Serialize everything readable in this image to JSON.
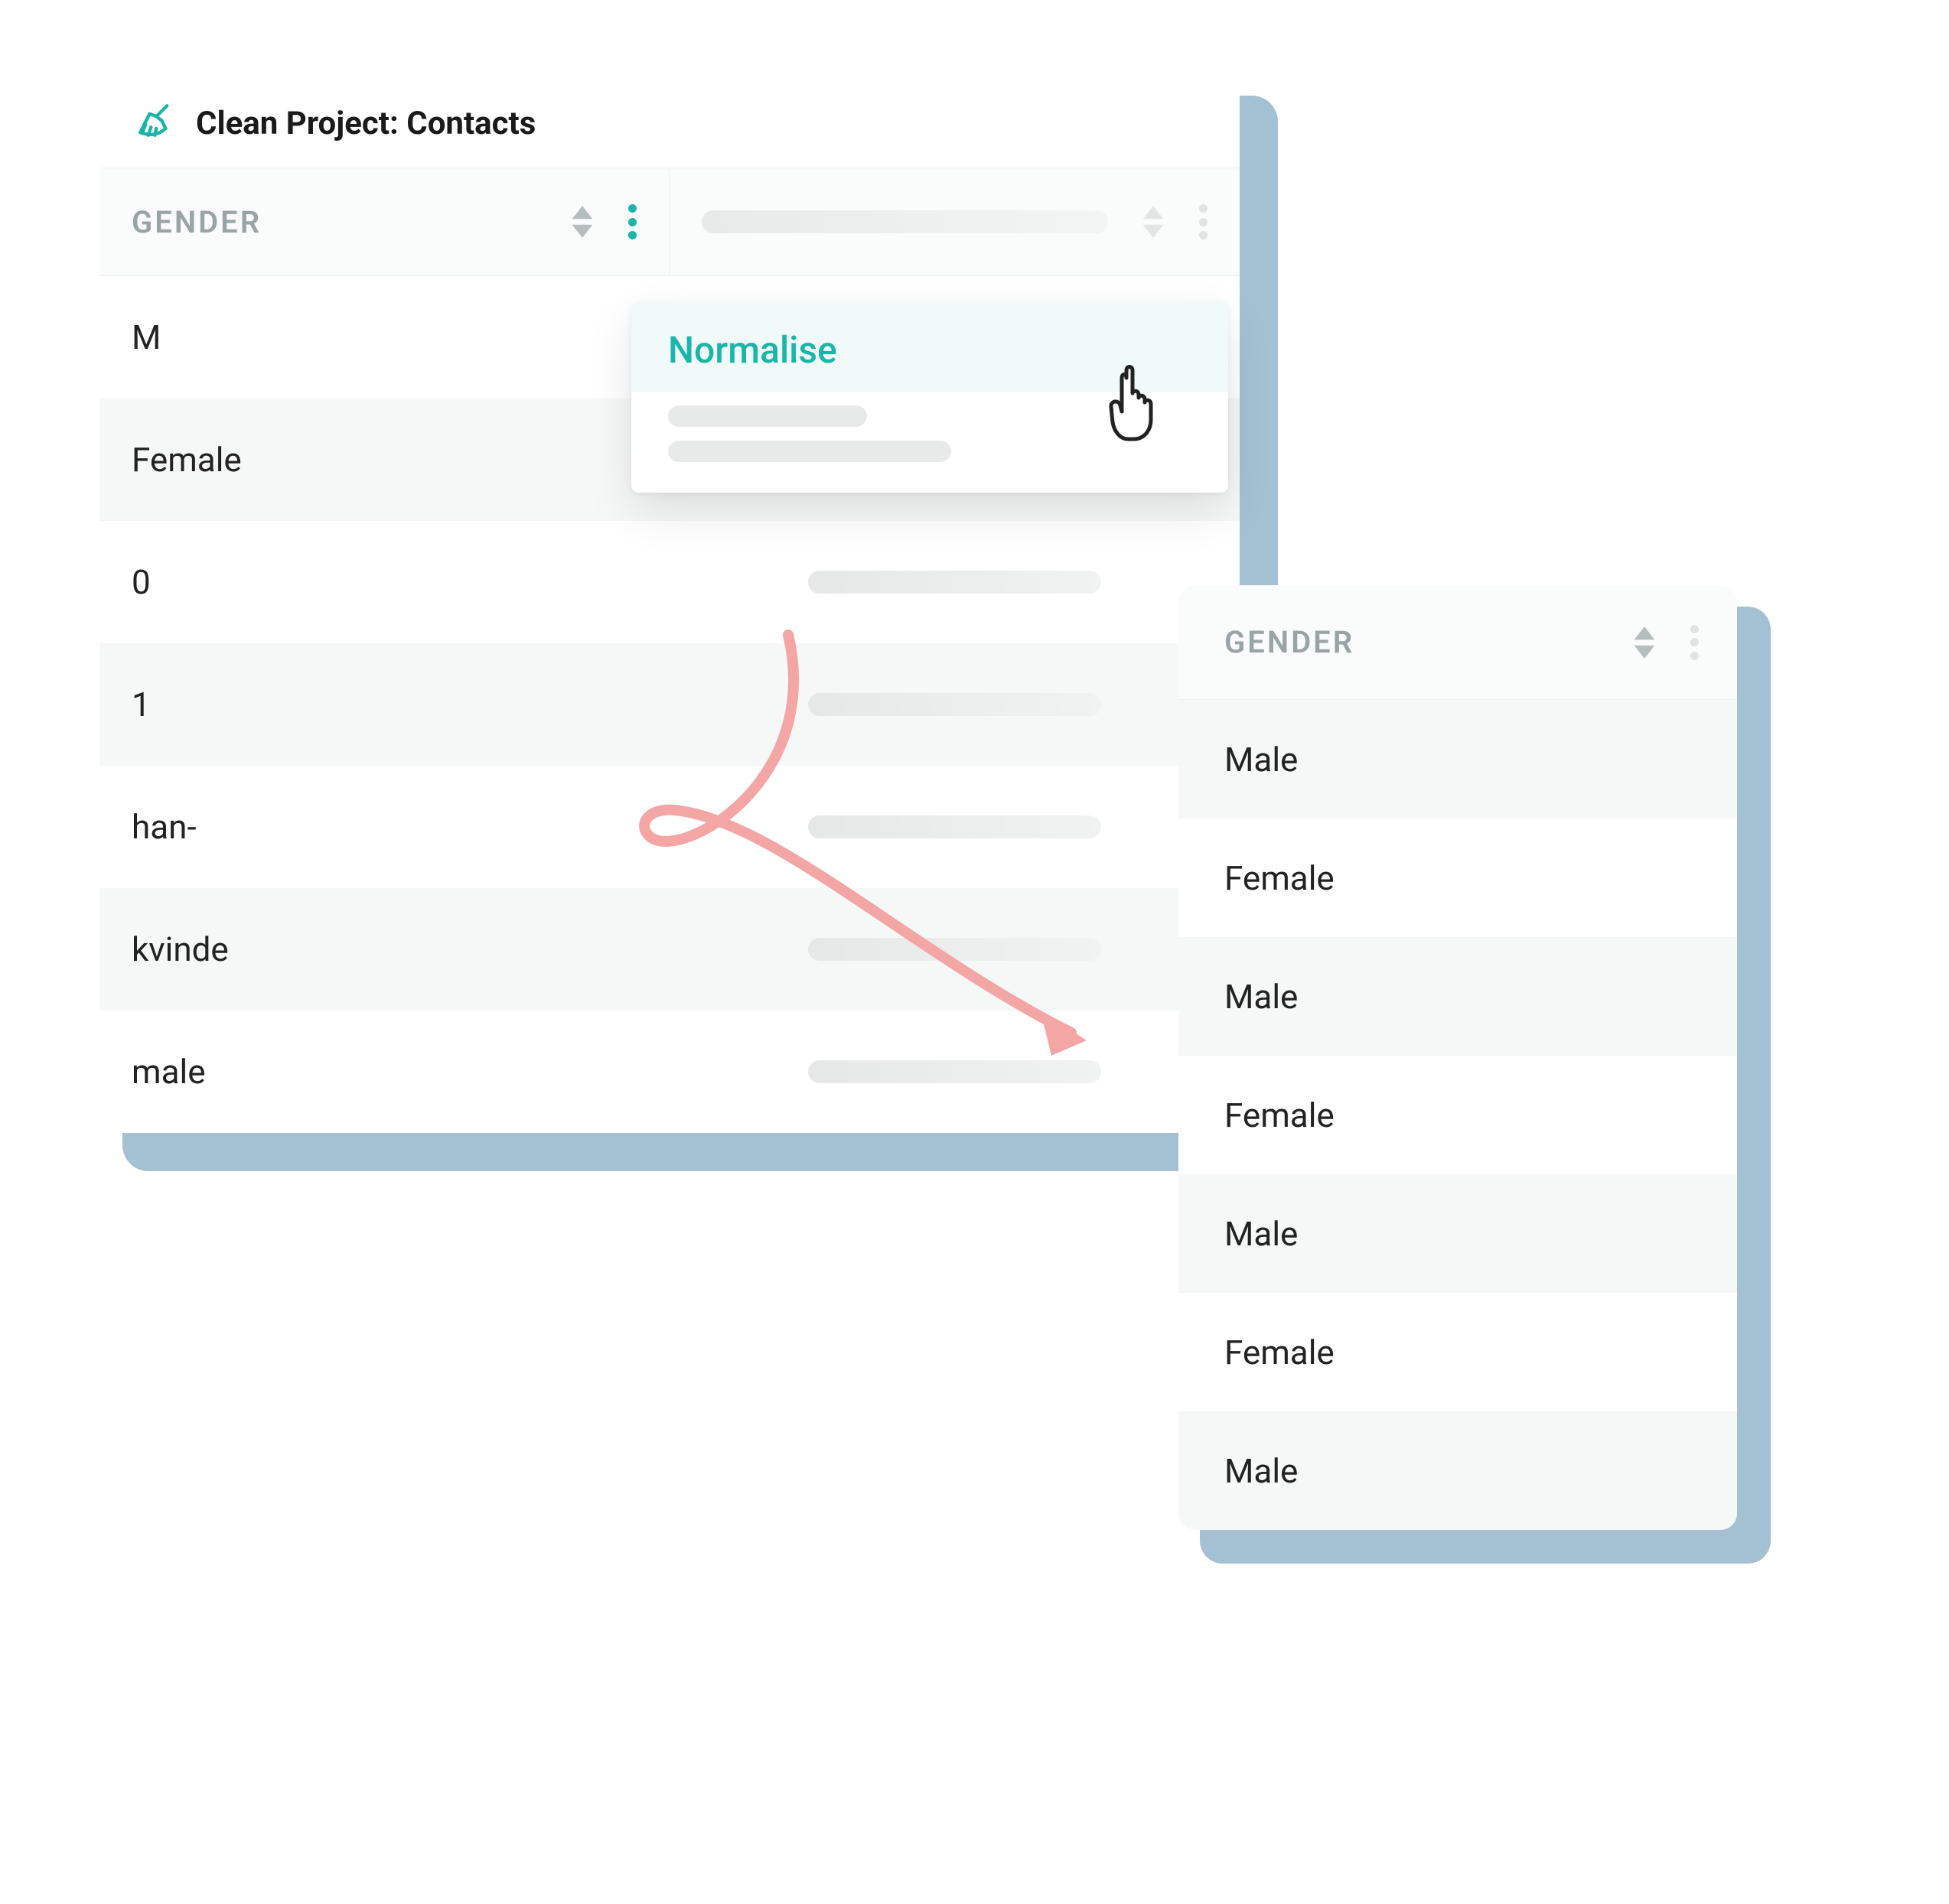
{
  "title": "Clean Project: Contacts",
  "column_header": "GENDER",
  "dropdown": {
    "active": "Normalise"
  },
  "before_rows": [
    "M",
    "Female",
    "0",
    "1",
    "han-",
    "kvinde",
    "male"
  ],
  "after_rows": [
    "Male",
    "Female",
    "Male",
    "Female",
    "Male",
    "Female",
    "Male"
  ],
  "colors": {
    "teal": "#19b6a9",
    "shadow": "#6f9dbe",
    "arrow": "#f3a6a3"
  }
}
